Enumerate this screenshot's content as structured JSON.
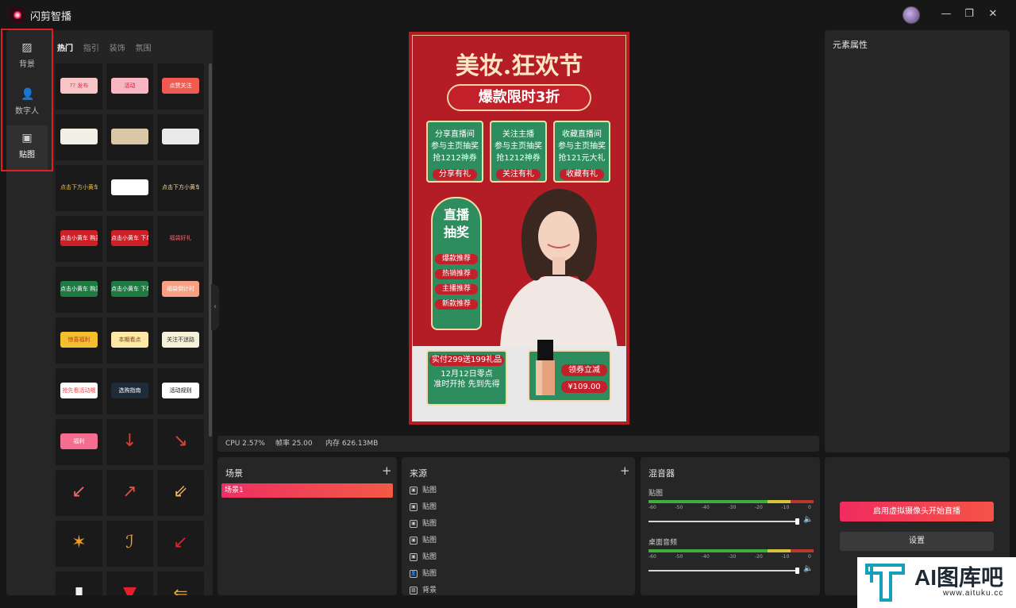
{
  "app": {
    "title": "闪剪智播"
  },
  "window_controls": {
    "minimize": "—",
    "maximize": "❐",
    "close": "✕"
  },
  "rail": {
    "items": [
      {
        "label": "背景",
        "icon": "background-icon"
      },
      {
        "label": "数字人",
        "icon": "digital-human-icon"
      },
      {
        "label": "贴图",
        "icon": "sticker-icon",
        "active": true
      }
    ]
  },
  "sticker_panel": {
    "tabs": [
      "热门",
      "指引",
      "装饰",
      "氛围"
    ],
    "active_tab": "热门",
    "stickers": [
      {
        "text": "?? 发布",
        "bg": "#f7c4c8",
        "fg": "#d43a52"
      },
      {
        "text": "活动",
        "bg": "#f7b6c2",
        "fg": "#c2203a"
      },
      {
        "text": "点赞关注",
        "bg": "#f05a50",
        "fg": "#ffffff"
      },
      {
        "text": "",
        "bg": "#f2efe6",
        "fg": "#333"
      },
      {
        "text": "",
        "bg": "#d9c7a8",
        "fg": "#333"
      },
      {
        "text": "",
        "bg": "#eaeaea",
        "fg": "#333"
      },
      {
        "text": "点击下方小黄车",
        "bg": "#1a1a1a",
        "fg": "#f2c04a"
      },
      {
        "text": "",
        "bg": "#ffffff",
        "fg": "#333"
      },
      {
        "text": "点击下方小黄车",
        "bg": "#1a1a1a",
        "fg": "#f0d9a0"
      },
      {
        "text": "点击小黄车 购买",
        "bg": "#cf2028",
        "fg": "#ffffff"
      },
      {
        "text": "点击小黄车 下单",
        "bg": "#cf2028",
        "fg": "#ffffff"
      },
      {
        "text": "福袋好礼",
        "bg": "#1a1a1a",
        "fg": "#f26a6a"
      },
      {
        "text": "点击小黄车 购买",
        "bg": "#1f7a44",
        "fg": "#ffffff"
      },
      {
        "text": "点击小黄车 下单",
        "bg": "#1f7a44",
        "fg": "#ffffff"
      },
      {
        "text": "福袋倒计时",
        "bg": "#f7a083",
        "fg": "#ffffff"
      },
      {
        "text": "惊喜福利",
        "bg": "#f2c02f",
        "fg": "#b53a18"
      },
      {
        "text": "本期看点",
        "bg": "#fde9a6",
        "fg": "#7a3d10"
      },
      {
        "text": "关注不迷路",
        "bg": "#f5f0d8",
        "fg": "#333"
      },
      {
        "text": "抢先看活动哦",
        "bg": "#ffffff",
        "fg": "#e44"
      },
      {
        "text": "选购指南",
        "bg": "#1e2c3a",
        "fg": "#ffffff"
      },
      {
        "text": "活动规则",
        "bg": "#ffffff",
        "fg": "#111"
      },
      {
        "text": "福利",
        "bg": "#f56d8f",
        "fg": "#ffffff"
      },
      {
        "text": "↓",
        "bg": "#1a1a1a",
        "fg": "#e6382c"
      },
      {
        "text": "↘",
        "bg": "#1a1a1a",
        "fg": "#e2462c"
      },
      {
        "text": "↙",
        "bg": "#1a1a1a",
        "fg": "#ef6a6a"
      },
      {
        "text": "↗",
        "bg": "#1a1a1a",
        "fg": "#e34d39"
      },
      {
        "text": "⇙",
        "bg": "#1a1a1a",
        "fg": "#f2b85a"
      },
      {
        "text": "✶",
        "bg": "#1a1a1a",
        "fg": "#f0a020"
      },
      {
        "text": "ℐ",
        "bg": "#1a1a1a",
        "fg": "#f0a020"
      },
      {
        "text": "↙",
        "bg": "#1a1a1a",
        "fg": "#e4202a"
      },
      {
        "text": "▮",
        "bg": "#1a1a1a",
        "fg": "#f0f0f0"
      },
      {
        "text": "▼",
        "bg": "#1a1a1a",
        "fg": "#e4202a"
      },
      {
        "text": "⇐",
        "bg": "#1a1a1a",
        "fg": "#f2a020"
      }
    ]
  },
  "preview": {
    "headline": "美妆.狂欢节",
    "banner": "爆款限时3折",
    "cards": [
      {
        "lines": [
          "分享直播间",
          "参与主页抽奖",
          "抢1212神券"
        ],
        "button": "分享有礼"
      },
      {
        "lines": [
          "关注主播",
          "参与主页抽奖",
          "抢1212神券"
        ],
        "button": "关注有礼"
      },
      {
        "lines": [
          "收藏直播间",
          "参与主页抽奖",
          "抢121元大礼"
        ],
        "button": "收藏有礼"
      }
    ],
    "lottery": {
      "title_line1": "直播",
      "title_line2": "抽奖",
      "tags": [
        "爆款推荐",
        "热销推荐",
        "主播推荐",
        "新款推荐"
      ]
    },
    "promo": {
      "top": "实付299送199礼品",
      "line1": "12月12日零点",
      "line2": "准时开抢 先到先得"
    },
    "coupon": {
      "label": "领券立减",
      "price": "¥109.00"
    }
  },
  "stats": {
    "cpu": "CPU 2.57%",
    "fps": "帧率 25.00",
    "memory": "内存 626.13MB"
  },
  "properties": {
    "title": "元素属性"
  },
  "scenes": {
    "title": "场景",
    "add": "+",
    "items": [
      "场景1"
    ]
  },
  "sources": {
    "title": "来源",
    "add": "+",
    "items": [
      {
        "label": "贴图",
        "icon": "sticker-icon"
      },
      {
        "label": "贴图",
        "icon": "sticker-icon"
      },
      {
        "label": "贴图",
        "icon": "sticker-icon"
      },
      {
        "label": "贴图",
        "icon": "sticker-icon"
      },
      {
        "label": "贴图",
        "icon": "sticker-icon"
      },
      {
        "label": "贴图",
        "icon": "person-icon"
      },
      {
        "label": "背景",
        "icon": "background-icon"
      }
    ]
  },
  "mixer": {
    "title": "混音器",
    "channels": [
      {
        "name": "贴图",
        "level": 1.0
      },
      {
        "name": "桌面音频",
        "level": 1.0
      }
    ],
    "ticks": [
      "-60",
      "-50",
      "-40",
      "-30",
      "-20",
      "-10",
      "0"
    ]
  },
  "actions": {
    "go_live": "启用虚拟摄像头开始直播",
    "settings": "设置"
  },
  "watermark": {
    "brand": "AI图库吧",
    "url": "www.aituku.cc"
  }
}
